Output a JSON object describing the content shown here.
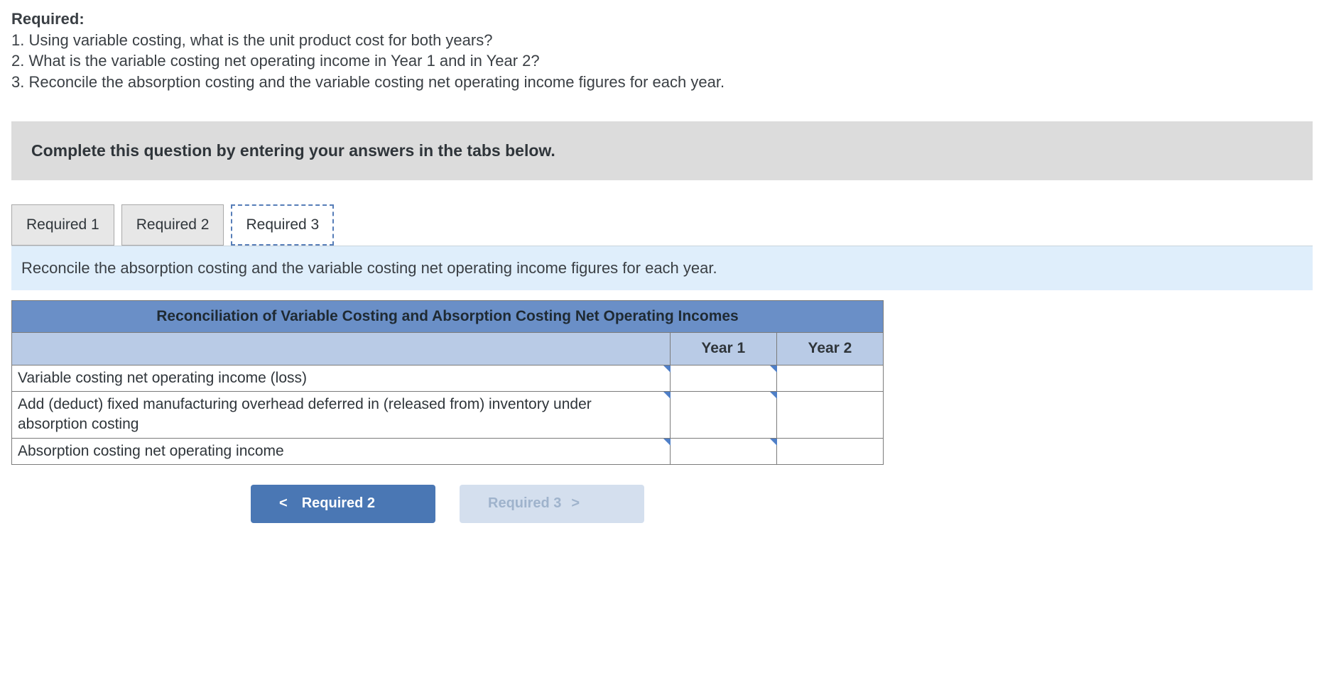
{
  "header": {
    "required_label": "Required:",
    "q1": "1. Using variable costing, what is the unit product cost for both years?",
    "q2": "2. What is the variable costing net operating income in Year 1 and in Year 2?",
    "q3": "3. Reconcile the absorption costing and the variable costing net operating income figures for each year."
  },
  "instruction": "Complete this question by entering your answers in the tabs below.",
  "tabs": {
    "t1": "Required 1",
    "t2": "Required 2",
    "t3": "Required 3"
  },
  "tab_instruction": "Reconcile the absorption costing and the variable costing net operating income figures for each year.",
  "table": {
    "title": "Reconciliation of Variable Costing and Absorption Costing Net Operating Incomes",
    "col_year1": "Year 1",
    "col_year2": "Year 2",
    "row1_label": "Variable costing net operating income (loss)",
    "row2_label": "Add (deduct) fixed manufacturing overhead deferred in (released from) inventory under absorption costing",
    "row3_label": "Absorption costing net operating income",
    "r1y1": "",
    "r1y2": "",
    "r2y1": "",
    "r2y2": "",
    "r3y1": "",
    "r3y2": ""
  },
  "nav": {
    "prev_chev": "<",
    "prev_label": "Required 2",
    "next_label": "Required 3",
    "next_chev": ">"
  }
}
